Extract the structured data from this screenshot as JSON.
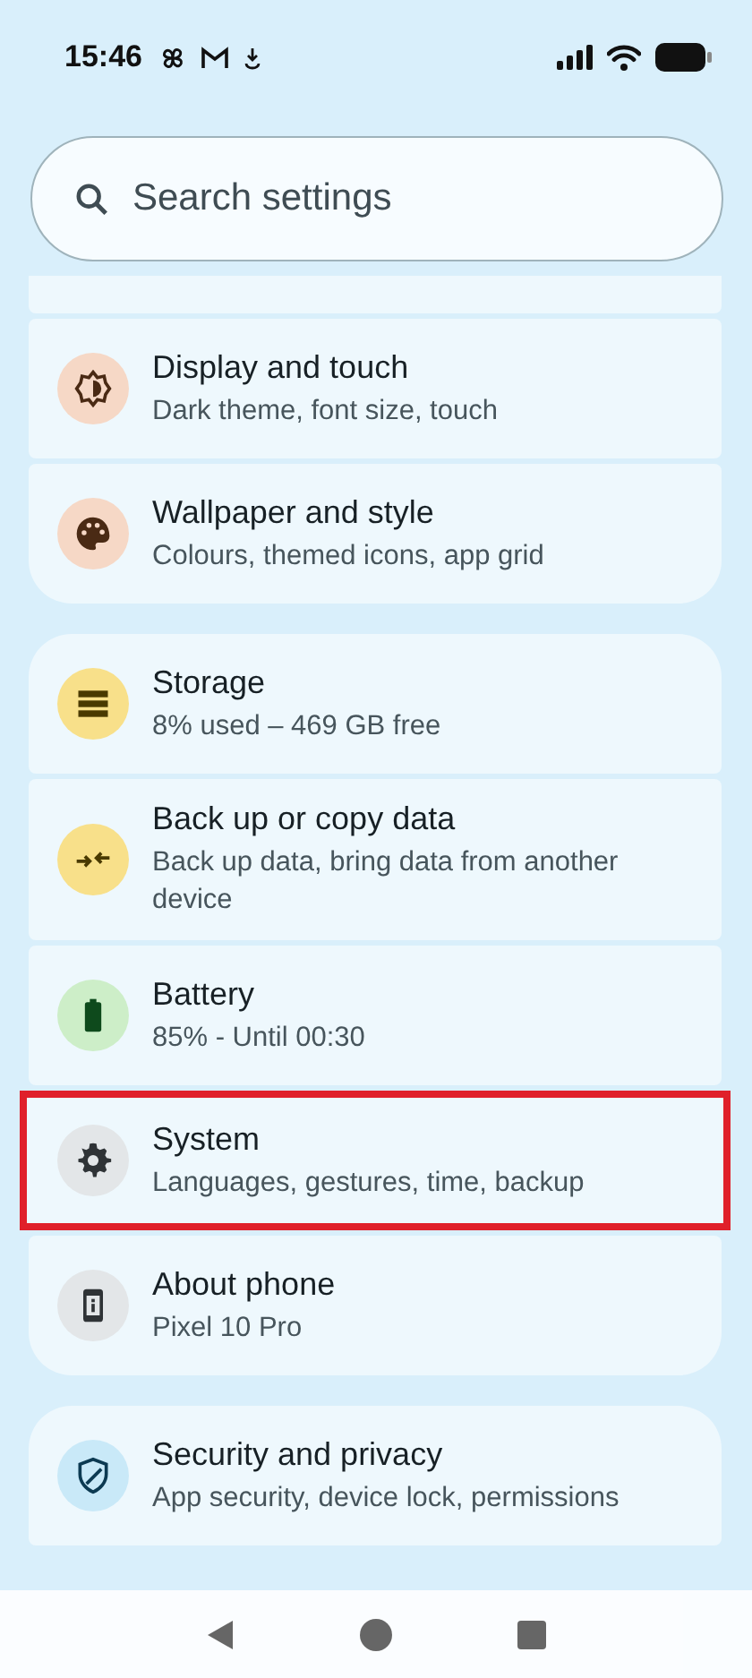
{
  "status_bar": {
    "time": "15:46"
  },
  "search": {
    "placeholder": "Search settings"
  },
  "groups": [
    {
      "items": [
        {
          "kind": "display",
          "color": "#f6d8c6",
          "title": "Display and touch",
          "subtitle": "Dark theme, font size, touch",
          "highlighted": false
        },
        {
          "kind": "wallpaper",
          "color": "#f6d8c6",
          "title": "Wallpaper and style",
          "subtitle": "Colours, themed icons, app grid",
          "highlighted": false
        }
      ]
    },
    {
      "items": [
        {
          "kind": "storage",
          "color": "#f8e08a",
          "title": "Storage",
          "subtitle": "8% used – 469 GB free",
          "highlighted": false
        },
        {
          "kind": "backup",
          "color": "#f8e08a",
          "title": "Back up or copy data",
          "subtitle": "Back up data, bring data from another device",
          "highlighted": false
        },
        {
          "kind": "battery",
          "color": "#cdeec8",
          "title": "Battery",
          "subtitle": "85% - Until 00:30",
          "highlighted": false
        },
        {
          "kind": "system",
          "color": "#e3e6e8",
          "title": "System",
          "subtitle": "Languages, gestures, time, backup",
          "highlighted": true
        },
        {
          "kind": "about",
          "color": "#e3e6e8",
          "title": "About phone",
          "subtitle": "Pixel 10 Pro",
          "highlighted": false
        }
      ]
    },
    {
      "items": [
        {
          "kind": "security",
          "color": "#c9e9f8",
          "title": "Security and privacy",
          "subtitle": "App security, device lock, permissions",
          "highlighted": false
        }
      ]
    }
  ]
}
